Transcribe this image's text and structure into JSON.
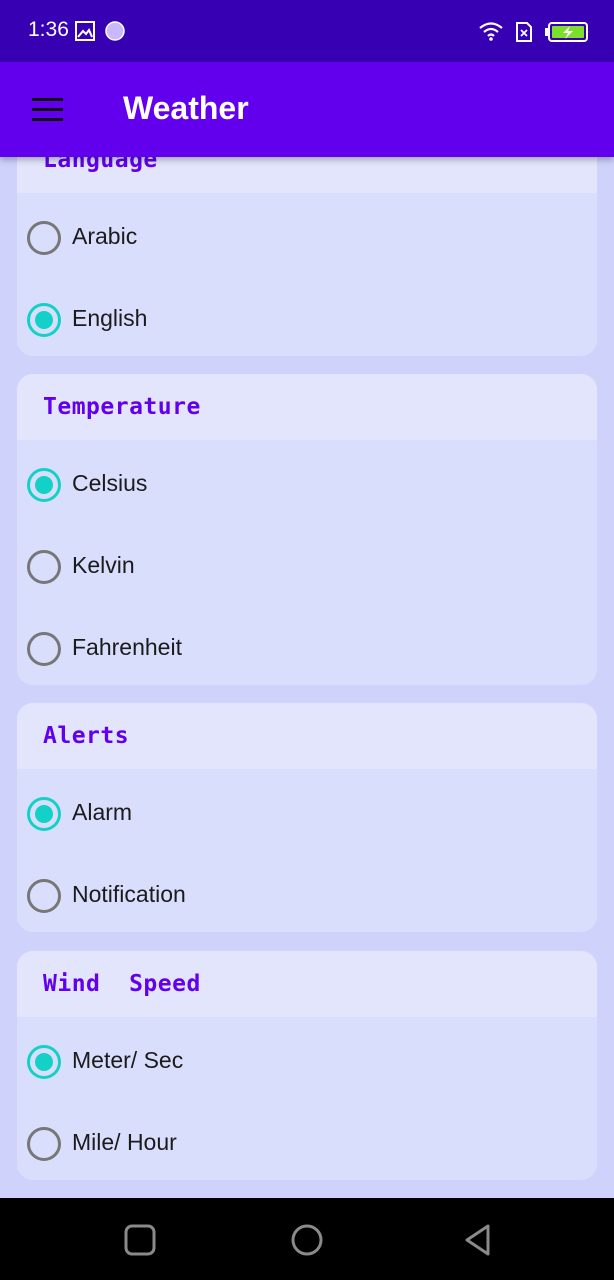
{
  "status_bar": {
    "time": "1:36",
    "icons": [
      "image-icon",
      "circle-notification-icon",
      "wifi-icon",
      "sim-icon",
      "battery-charging-icon"
    ],
    "battery_color": "#7ddf2c"
  },
  "app_bar": {
    "title": "Weather",
    "menu_icon": "hamburger-menu-icon",
    "color": "#6200ee"
  },
  "accent_color": "#14d1c8",
  "sections": [
    {
      "title": "Language",
      "options": [
        {
          "label": "Arabic",
          "selected": false
        },
        {
          "label": "English",
          "selected": true
        }
      ]
    },
    {
      "title": "Temperature",
      "options": [
        {
          "label": "Celsius",
          "selected": true
        },
        {
          "label": "Kelvin",
          "selected": false
        },
        {
          "label": "Fahrenheit",
          "selected": false
        }
      ]
    },
    {
      "title": "Alerts",
      "options": [
        {
          "label": "Alarm",
          "selected": true
        },
        {
          "label": "Notification",
          "selected": false
        }
      ]
    },
    {
      "title": "Wind  Speed",
      "options": [
        {
          "label": "Meter/ Sec",
          "selected": true
        },
        {
          "label": "Mile/ Hour",
          "selected": false
        }
      ]
    }
  ],
  "nav_bar": {
    "buttons": [
      "recents-square-icon",
      "home-circle-icon",
      "back-triangle-icon"
    ]
  }
}
